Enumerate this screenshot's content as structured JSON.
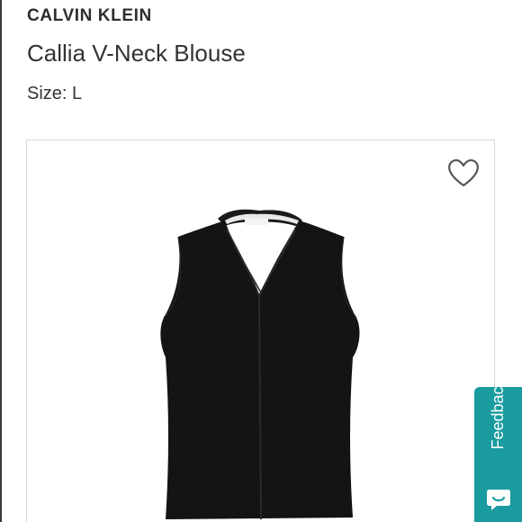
{
  "product": {
    "brand": "CALVIN KLEIN",
    "title": "Callia V-Neck Blouse",
    "size_text": "Size: L"
  },
  "image": {
    "alt": "Black sleeveless v-neck blouse",
    "icon": "favorite-heart-icon"
  },
  "feedback": {
    "label": "Feedback",
    "icon": "chat-smile-icon",
    "color": "#1a9b9f"
  }
}
